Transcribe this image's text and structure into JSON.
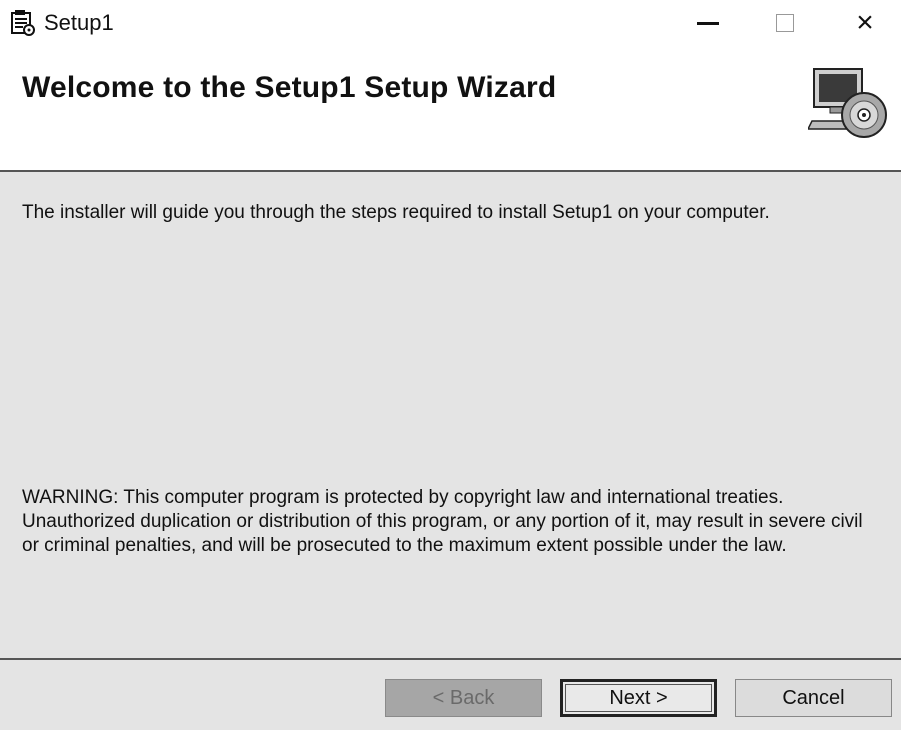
{
  "window": {
    "title": "Setup1",
    "icon": "setup-installer-icon",
    "controls": {
      "minimize": "minimize-icon",
      "maximize": "maximize-icon",
      "close_glyph": "×"
    }
  },
  "header": {
    "title": "Welcome to the Setup1 Setup Wizard",
    "graphic": "computer-cd-icon"
  },
  "body": {
    "intro": "The installer will guide you through the steps required to install Setup1 on your computer.",
    "warning": "WARNING: This computer program is protected by copyright law and international treaties. Unauthorized duplication or distribution of this program, or any portion of it, may result in severe civil or criminal penalties, and will be prosecuted to the maximum extent possible under the law."
  },
  "buttons": {
    "back": "< Back",
    "next": "Next >",
    "cancel": "Cancel"
  },
  "colors": {
    "body_background": "#e4e4e4",
    "disabled_button": "#a6a6a6",
    "rule": "#555555"
  }
}
